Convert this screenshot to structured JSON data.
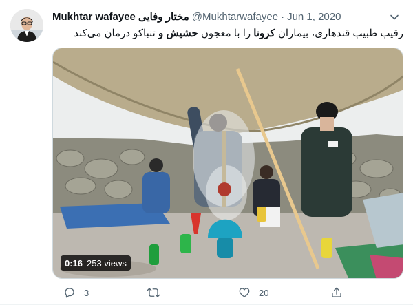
{
  "tweet": {
    "author_name": "Mukhtar wafayee",
    "author_name_arabic": "مختار وفایی",
    "handle": "@Mukhtarwafayee",
    "separator": "·",
    "date": "Jun 1, 2020",
    "text_part1": "رقیب طبیب قندهاری، بیماران ",
    "text_bold1": "کرونا",
    "text_part2": " را با معجون ",
    "text_bold2": "حشیش و",
    "text_part3": " تنباکو درمان می‌کند"
  },
  "media": {
    "time": "0:16",
    "views": "253 views"
  },
  "actions": {
    "reply_count": "3",
    "retweet_count": "",
    "like_count": "20"
  },
  "icons": [
    "avatar",
    "chevron-down-icon",
    "reply-icon",
    "retweet-icon",
    "like-icon",
    "share-icon"
  ],
  "colors": {
    "text_primary": "#0f1419",
    "text_secondary": "#536471",
    "divider": "#eff3f4"
  }
}
